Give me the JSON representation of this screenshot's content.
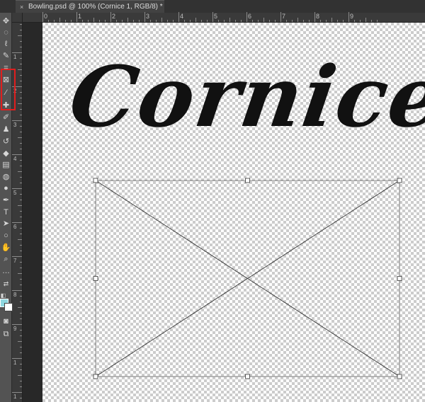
{
  "document_tab": {
    "close_glyph": "×",
    "title": "Bowling.psd @ 100% (Cornice 1, RGB/8) *"
  },
  "rulers": {
    "horizontal_labels": [
      "0",
      "1",
      "2",
      "3",
      "4",
      "5",
      "6",
      "7",
      "8",
      "9"
    ],
    "vertical_labels": [
      "1",
      "2",
      "3",
      "4",
      "5",
      "6",
      "7",
      "8",
      "9",
      "1",
      "1",
      "1"
    ]
  },
  "toolbar": {
    "tools": [
      {
        "name": "move-tool-icon",
        "glyph": "✥"
      },
      {
        "name": "marquee-tool-icon",
        "glyph": "◌"
      },
      {
        "name": "lasso-tool-icon",
        "glyph": "ℓ"
      },
      {
        "name": "quick-select-tool-icon",
        "glyph": "✎"
      },
      {
        "name": "crop-tool-icon",
        "glyph": "⌗"
      },
      {
        "name": "frame-tool-icon",
        "glyph": "⊠"
      },
      {
        "name": "eyedropper-tool-icon",
        "glyph": "⁄"
      },
      {
        "name": "healing-brush-tool-icon",
        "glyph": "✚"
      },
      {
        "name": "brush-tool-icon",
        "glyph": "✐"
      },
      {
        "name": "clone-stamp-tool-icon",
        "glyph": "♟"
      },
      {
        "name": "history-brush-tool-icon",
        "glyph": "↺"
      },
      {
        "name": "eraser-tool-icon",
        "glyph": "◆"
      },
      {
        "name": "gradient-tool-icon",
        "glyph": "▤"
      },
      {
        "name": "blur-tool-icon",
        "glyph": "◍"
      },
      {
        "name": "dodge-tool-icon",
        "glyph": "●"
      },
      {
        "name": "pen-tool-icon",
        "glyph": "✒"
      },
      {
        "name": "type-tool-icon",
        "glyph": "T"
      },
      {
        "name": "path-selection-tool-icon",
        "glyph": "➤"
      },
      {
        "name": "shape-tool-icon",
        "glyph": "○"
      },
      {
        "name": "hand-tool-icon",
        "glyph": "✋"
      },
      {
        "name": "zoom-tool-icon",
        "glyph": "⌕"
      },
      {
        "name": "more-tools-icon",
        "glyph": "…"
      }
    ],
    "extra_glyphs": {
      "swap_colors": "⇄",
      "default_colors": "◧",
      "quick_mask": "◙",
      "screen_mode": "⧉"
    },
    "colors": {
      "foreground": "#8fd8e0",
      "background": "#ffffff",
      "highlight_box": "#e01e1e"
    }
  },
  "canvas": {
    "headline_text": "Cornice",
    "text_color": "#111111"
  }
}
